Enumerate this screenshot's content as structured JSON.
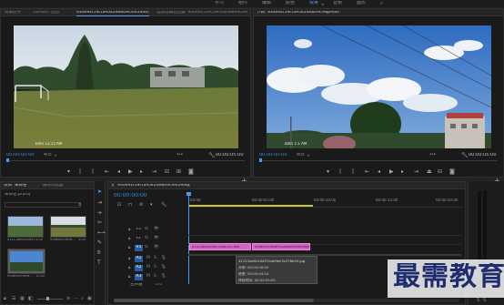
{
  "workspaces": {
    "items": [
      "学习",
      "组件",
      "编辑",
      "颜色",
      "效果",
      "音频",
      "图形"
    ],
    "active": "效果"
  },
  "source_monitor": {
    "tabs": [
      "效果控件",
      "Lumetri 范围",
      "93de92f59cfa9542de809cfee59a4f.jpg",
      "音频剪辑混合器: 93de92f59cfa9542de809cfee59a4f"
    ],
    "timecode_left": "00:00:00:00",
    "fit_label": "适合",
    "page": "1/2",
    "timecode_right": "00:00:05:00",
    "watermark": "Bitin 12:15 AM"
  },
  "program_monitor": {
    "tab": "节目: 93de92f59cfa9542de809cfee59a4f",
    "timecode_left": "00:00:00:00",
    "fit_label": "适合",
    "page": "1/2",
    "timecode_right": "00:00:05:00",
    "watermark": "Bitin 1:1 AM"
  },
  "project": {
    "tabs": [
      "项目: 未命名",
      "媒体浏览器"
    ],
    "filename": "未命名.prproj",
    "items": [
      {
        "label": "41112da92c0e57a4...",
        "duration": "5:00"
      },
      {
        "label": "93de92f59cfa...",
        "duration": "5:00"
      },
      {
        "label": "93de92f59cfa...",
        "duration": "10:00"
      }
    ]
  },
  "timeline": {
    "tab": "93de92f59cfa9542de809cfee59a4f",
    "timecode": "00:00:00:00",
    "ruler": [
      "00:00",
      "00:00:05:00",
      "00:00:10:00",
      "00:00:15:00",
      "00:00:20:00"
    ],
    "video_tracks": [
      "V3",
      "V2",
      "V1"
    ],
    "audio_tracks": [
      "A1",
      "A2",
      "A3"
    ],
    "master": "主声道",
    "master_value": "0.0",
    "clips": [
      {
        "label": "41112da92c0e57a4e3c27864"
      },
      {
        "label": "93de92f59cfa9542de809cfee59a4f"
      }
    ],
    "tooltip": {
      "title": "41112da92c0e57a4e9ec3c278e43.jpg",
      "start": "开始: 00:00:00:00",
      "end": "结束: 00:00:04:24",
      "duration": "持续时间: 00:00:05:00"
    }
  },
  "watermark_brand": "最需教育",
  "colors": {
    "accent_blue": "#3d8fe6",
    "clip_pink": "#d464c4",
    "playhead": "#4a9cf0"
  }
}
